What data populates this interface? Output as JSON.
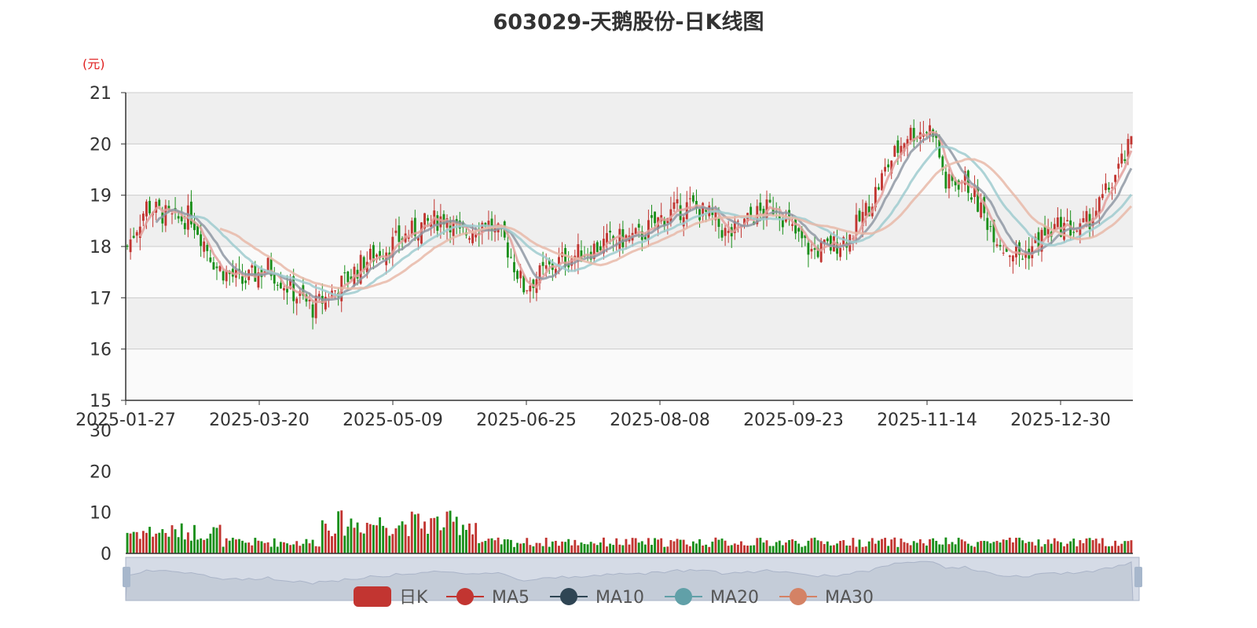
{
  "chart_data": {
    "type": "candlestick",
    "title": "603029-天鹅股份-日K线图",
    "y_unit": "(元)",
    "price_axis": {
      "ylim": [
        15,
        21
      ],
      "ticks": [
        15,
        16,
        17,
        18,
        19,
        20,
        21
      ]
    },
    "volume_axis": {
      "ylim": [
        0,
        30
      ],
      "ticks": [
        0,
        10,
        20,
        30
      ]
    },
    "x_tick_labels": [
      "2025-01-27",
      "2025-03-20",
      "2025-05-09",
      "2025-06-25",
      "2025-08-08",
      "2025-09-23",
      "2025-11-14",
      "2025-12-30"
    ],
    "legend": [
      "日K",
      "MA5",
      "MA10",
      "MA20",
      "MA30"
    ],
    "colors": {
      "up": "#c23531",
      "down": "#1a8f1a",
      "MA5": "#e3a09c",
      "MA10": "#8f98a3",
      "MA20": "#9fcbcf",
      "MA30": "#e8b9a8",
      "legend_k": "#c23531",
      "legend_ma5": "#c23531",
      "legend_ma10": "#2f4554",
      "legend_ma20": "#61a0a8",
      "legend_ma30": "#d48265",
      "grid_band": "#efefef"
    },
    "trend_anchors": [
      {
        "i": 0,
        "p": 18.0
      },
      {
        "i": 6,
        "p": 18.8
      },
      {
        "i": 15,
        "p": 18.5
      },
      {
        "i": 20,
        "p": 18.6
      },
      {
        "i": 28,
        "p": 17.6
      },
      {
        "i": 36,
        "p": 17.3
      },
      {
        "i": 44,
        "p": 17.6
      },
      {
        "i": 52,
        "p": 17.1
      },
      {
        "i": 58,
        "p": 16.8
      },
      {
        "i": 66,
        "p": 17.2
      },
      {
        "i": 74,
        "p": 17.7
      },
      {
        "i": 84,
        "p": 18.1
      },
      {
        "i": 92,
        "p": 18.4
      },
      {
        "i": 100,
        "p": 18.6
      },
      {
        "i": 104,
        "p": 18.2
      },
      {
        "i": 112,
        "p": 18.5
      },
      {
        "i": 118,
        "p": 18.1
      },
      {
        "i": 124,
        "p": 17.2
      },
      {
        "i": 128,
        "p": 17.4
      },
      {
        "i": 135,
        "p": 17.7
      },
      {
        "i": 143,
        "p": 17.9
      },
      {
        "i": 151,
        "p": 18.1
      },
      {
        "i": 160,
        "p": 18.2
      },
      {
        "i": 168,
        "p": 18.6
      },
      {
        "i": 176,
        "p": 18.8
      },
      {
        "i": 182,
        "p": 18.6
      },
      {
        "i": 188,
        "p": 18.2
      },
      {
        "i": 196,
        "p": 18.6
      },
      {
        "i": 203,
        "p": 18.8
      },
      {
        "i": 208,
        "p": 18.3
      },
      {
        "i": 214,
        "p": 17.9
      },
      {
        "i": 220,
        "p": 18.0
      },
      {
        "i": 226,
        "p": 18.2
      },
      {
        "i": 232,
        "p": 18.8
      },
      {
        "i": 238,
        "p": 19.6
      },
      {
        "i": 244,
        "p": 20.2
      },
      {
        "i": 252,
        "p": 20.3
      },
      {
        "i": 256,
        "p": 19.2
      },
      {
        "i": 262,
        "p": 19.3
      },
      {
        "i": 268,
        "p": 18.6
      },
      {
        "i": 274,
        "p": 18.0
      },
      {
        "i": 280,
        "p": 17.8
      },
      {
        "i": 286,
        "p": 18.2
      },
      {
        "i": 292,
        "p": 18.4
      },
      {
        "i": 298,
        "p": 18.3
      },
      {
        "i": 304,
        "p": 18.8
      },
      {
        "i": 310,
        "p": 19.5
      },
      {
        "i": 314,
        "p": 20.0
      }
    ]
  }
}
